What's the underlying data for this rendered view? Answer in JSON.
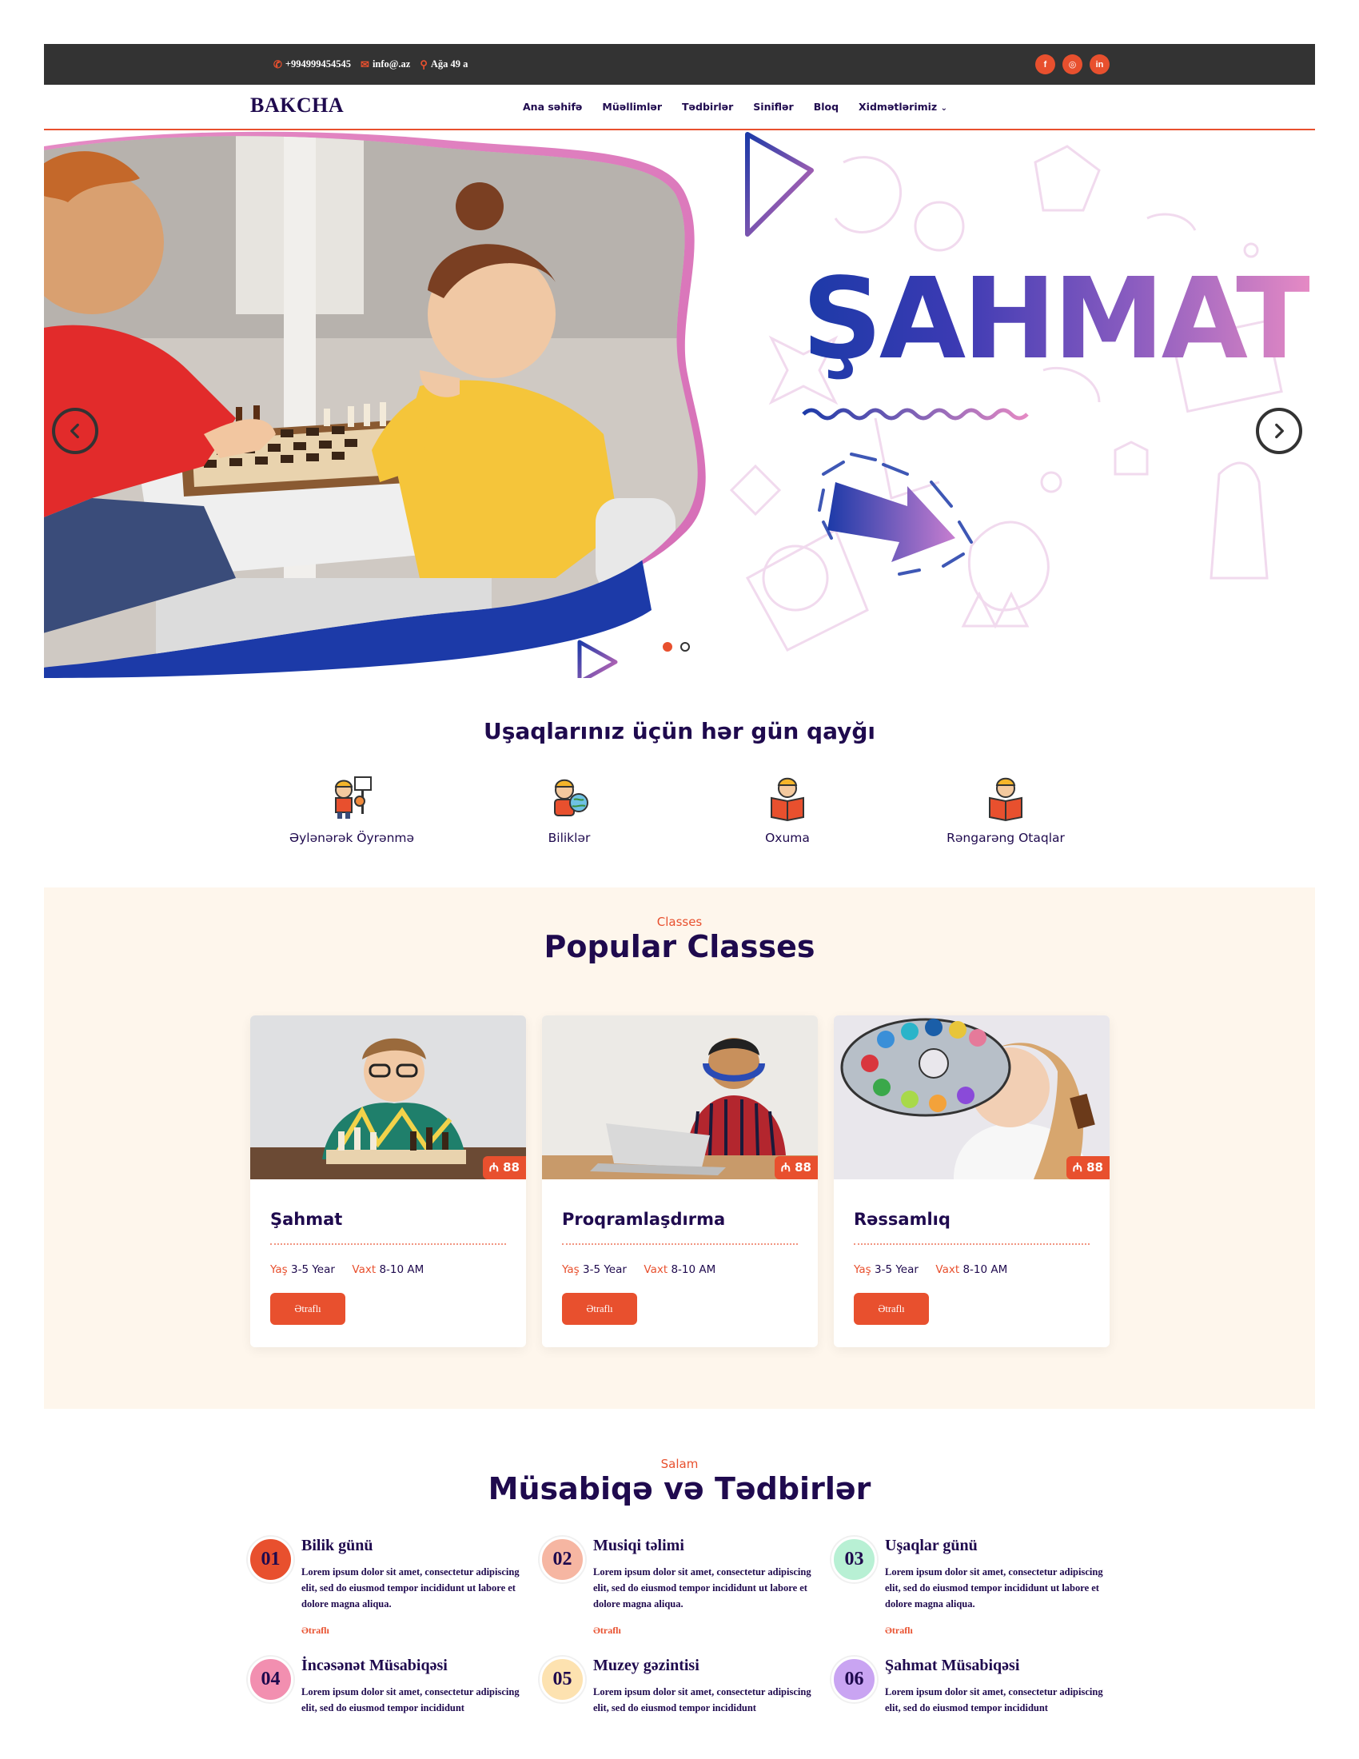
{
  "topbar": {
    "phone": "+994999454545",
    "email": "info@.az",
    "address": "Ağa 49 a",
    "social": [
      {
        "icon": "facebook-icon",
        "glyph": "f"
      },
      {
        "icon": "instagram-icon",
        "glyph": "◎"
      },
      {
        "icon": "linkedin-icon",
        "glyph": "in"
      }
    ]
  },
  "nav": {
    "logo": "BAKCHA",
    "items": [
      "Ana səhifə",
      "Müəllimlər",
      "Tədbirlər",
      "Siniflər",
      "Bloq",
      "Xidmətlərimiz"
    ]
  },
  "hero": {
    "title": "ŞAHMAT",
    "slide_count": 2,
    "active_slide": 1
  },
  "care": {
    "title": "Uşaqlarınız üçün hər gün qayğı",
    "features": [
      {
        "label": "Əylənərək Öyrənmə",
        "icon": "child-basketball-icon"
      },
      {
        "label": "Biliklər",
        "icon": "child-globe-icon"
      },
      {
        "label": "Oxuma",
        "icon": "child-reading-icon"
      },
      {
        "label": "Rəngarəng Otaqlar",
        "icon": "child-reading-icon"
      }
    ]
  },
  "classes": {
    "eyebrow": "Classes",
    "title": "Popular Classes",
    "age_label": "Yaş",
    "time_label": "Vaxt",
    "cards": [
      {
        "title": "Şahmat",
        "price": "₼ 88",
        "age": "3-5 Year",
        "time": "8-10 AM",
        "button": "Ətraflı"
      },
      {
        "title": "Proqramlaşdırma",
        "price": "₼ 88",
        "age": "3-5 Year",
        "time": "8-10 AM",
        "button": "Ətraflı"
      },
      {
        "title": "Rəssamlıq",
        "price": "₼ 88",
        "age": "3-5 Year",
        "time": "8-10 AM",
        "button": "Ətraflı"
      }
    ]
  },
  "events": {
    "eyebrow": "Salam",
    "title": "Müsabiqə və Tədbirlər",
    "items": [
      {
        "num": "01",
        "title": "Bilik günü",
        "color": "#e8502e",
        "desc": "Lorem ipsum dolor sit amet, consectetur adipiscing elit, sed do eiusmod tempor incididunt ut labore et dolore magna aliqua.",
        "more": "Ətraflı"
      },
      {
        "num": "02",
        "title": "Musiqi təlimi",
        "color": "#f6b6a2",
        "desc": "Lorem ipsum dolor sit amet, consectetur adipiscing elit, sed do eiusmod tempor incididunt ut labore et dolore magna aliqua.",
        "more": "Ətraflı"
      },
      {
        "num": "03",
        "title": "Uşaqlar günü",
        "color": "#b8f0d4",
        "desc": "Lorem ipsum dolor sit amet, consectetur adipiscing elit, sed do eiusmod tempor incididunt ut labore et dolore magna aliqua.",
        "more": "Ətraflı"
      },
      {
        "num": "04",
        "title": "İncəsənət Müsabiqəsi",
        "color": "#f28fb0",
        "desc": "Lorem ipsum dolor sit amet, consectetur adipiscing elit, sed do eiusmod tempor incididunt",
        "more": ""
      },
      {
        "num": "05",
        "title": "Muzey gəzintisi",
        "color": "#fde2b0",
        "desc": "Lorem ipsum dolor sit amet, consectetur adipiscing elit, sed do eiusmod tempor incididunt",
        "more": ""
      },
      {
        "num": "06",
        "title": "Şahmat Müsabiqəsi",
        "color": "#c9a4f2",
        "desc": "Lorem ipsum dolor sit amet, consectetur adipiscing elit, sed do eiusmod tempor incididunt",
        "more": ""
      }
    ]
  }
}
